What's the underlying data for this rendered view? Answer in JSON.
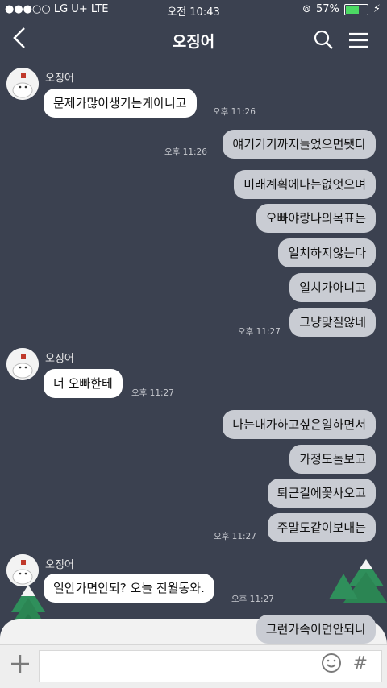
{
  "status": {
    "carrier": "●●●○○ LG U+  LTE",
    "time": "오전 10:43",
    "battery": "57%",
    "battery_level": 0.57
  },
  "nav": {
    "title": "오징어"
  },
  "sender": {
    "name": "오징어"
  },
  "messages": [
    {
      "text": "문제가많이생기는게아니고",
      "time": "오후 11:26"
    },
    {
      "text": "얘기거기까지들었으면됏다",
      "time": "오후 11:26"
    },
    {
      "text": "미래계획에나는없엇으며"
    },
    {
      "text": "오빠야랑나의목표는"
    },
    {
      "text": "일치하지않는다"
    },
    {
      "text": "일치가아니고"
    },
    {
      "text": "그냥맞질않네",
      "time": "오후 11:27"
    },
    {
      "text": "너 오빠한테",
      "time": "오후 11:27"
    },
    {
      "text": "나는내가하고싶은일하면서"
    },
    {
      "text": "가정도돌보고"
    },
    {
      "text": "퇴근길에꽃사오고"
    },
    {
      "text": "주말도같이보내는",
      "time": "오후 11:27"
    },
    {
      "text": "일안가면안되? 오늘 진월동와.",
      "time": "오후 11:27"
    },
    {
      "text": "그런가족이면안되나"
    }
  ],
  "input": {
    "hash": "#"
  }
}
